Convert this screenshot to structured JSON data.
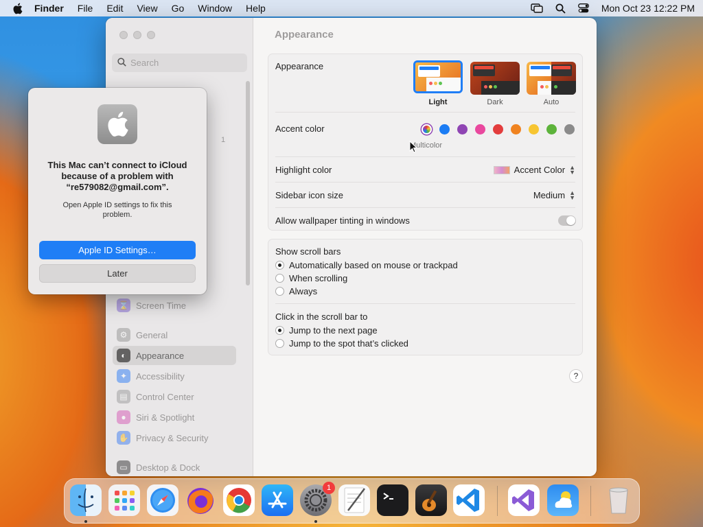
{
  "menubar": {
    "app": "Finder",
    "items": [
      "File",
      "Edit",
      "View",
      "Go",
      "Window",
      "Help"
    ],
    "datetime": "Mon Oct 23  12:22 PM"
  },
  "sidebar": {
    "search_placeholder": "Search",
    "badge": "1",
    "items": [
      {
        "label": "Screen Time",
        "icon": "hourglass-icon",
        "color": "#8a6fd6"
      },
      {
        "label": "General",
        "icon": "gear-icon",
        "color": "#9b9b9b"
      },
      {
        "label": "Appearance",
        "icon": "appearance-icon",
        "color": "#333333"
      },
      {
        "label": "Accessibility",
        "icon": "accessibility-icon",
        "color": "#2e7cf6"
      },
      {
        "label": "Control Center",
        "icon": "control-center-icon",
        "color": "#9b9b9b"
      },
      {
        "label": "Siri & Spotlight",
        "icon": "siri-icon",
        "color": "#d65ab5"
      },
      {
        "label": "Privacy & Security",
        "icon": "hand-icon",
        "color": "#3d7cf0"
      },
      {
        "label": "Desktop & Dock",
        "icon": "dock-icon",
        "color": "#333333"
      }
    ]
  },
  "content": {
    "title": "Appearance",
    "appearance_label": "Appearance",
    "themes": [
      {
        "label": "Light",
        "selected": true
      },
      {
        "label": "Dark",
        "selected": false
      },
      {
        "label": "Auto",
        "selected": false
      }
    ],
    "accent_label": "Accent color",
    "accent_colors": [
      "multicolor",
      "#1b7cf4",
      "#8f45b3",
      "#e9489e",
      "#e33d3d",
      "#f08320",
      "#f7c531",
      "#5db33b",
      "#8b8b8b"
    ],
    "accent_caption": "Multicolor",
    "highlight_label": "Highlight color",
    "highlight_value": "Accent Color",
    "sidebar_icon_label": "Sidebar icon size",
    "sidebar_icon_value": "Medium",
    "wallpaper_tint_label": "Allow wallpaper tinting in windows",
    "scroll_title": "Show scroll bars",
    "scroll_options": [
      {
        "label": "Automatically based on mouse or trackpad",
        "checked": true
      },
      {
        "label": "When scrolling",
        "checked": false
      },
      {
        "label": "Always",
        "checked": false
      }
    ],
    "click_title": "Click in the scroll bar to",
    "click_options": [
      {
        "label": "Jump to the next page",
        "checked": true
      },
      {
        "label": "Jump to the spot that’s clicked",
        "checked": false
      }
    ],
    "help": "?"
  },
  "dialog": {
    "title": "This Mac can’t connect to iCloud because of a problem with “re579082@gmail.com”.",
    "message": "Open Apple ID settings to fix this problem.",
    "primary_button": "Apple ID Settings…",
    "secondary_button": "Later"
  },
  "dock": {
    "apps": [
      "Finder",
      "Launchpad",
      "Safari",
      "Firefox",
      "Chrome",
      "App Store",
      "System Settings",
      "TextEdit",
      "Terminal",
      "GarageBand",
      "Visual Studio Code",
      "Visual Studio",
      "Weather",
      "Trash"
    ],
    "settings_badge": "1"
  }
}
